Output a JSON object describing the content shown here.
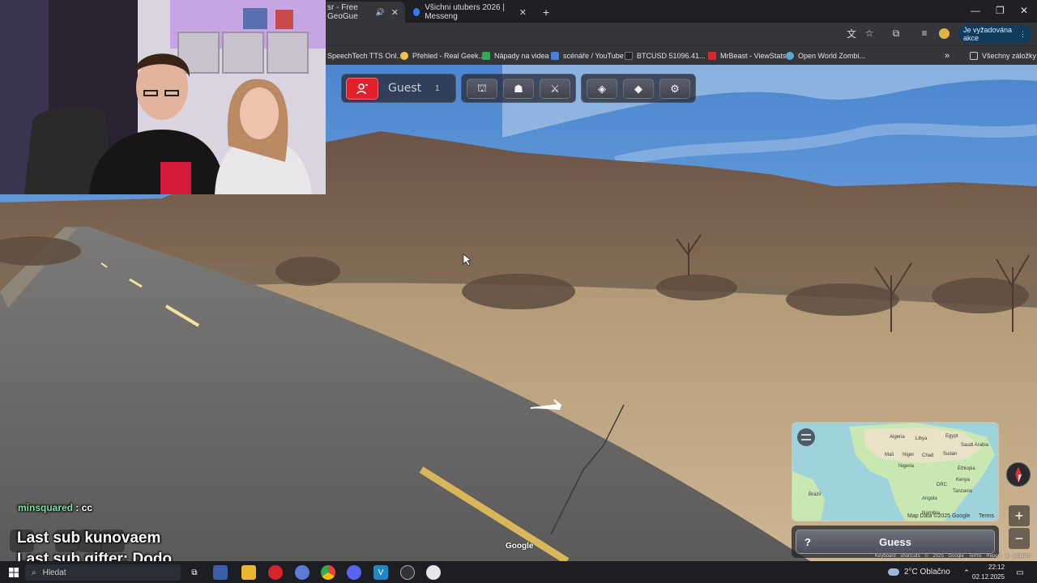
{
  "browser": {
    "tabs": [
      {
        "title": "sr - Free GeoGue",
        "active": true,
        "audio_icon": "speaker-icon"
      },
      {
        "title": "Všichni utubers 2026 | Messeng",
        "active": false,
        "icon": "messenger-icon"
      }
    ],
    "new_tab_label": "+",
    "action_pill": "Je vyžadována akce",
    "bookmarks": [
      {
        "label": "SpeechTech TTS Onl...",
        "color": "#6a6f7c"
      },
      {
        "label": "Přehled - Real Geek...",
        "color": "#f2c14e"
      },
      {
        "label": "Nápady na videa",
        "color": "#34a853"
      },
      {
        "label": "scénáře / YouTube",
        "color": "#4a7fe0"
      },
      {
        "label": "BTCUSD 51096.41...",
        "color": "#222222"
      },
      {
        "label": "MrBeast - ViewStats",
        "color": "#d62a2a"
      },
      {
        "label": "Open World Zombi...",
        "color": "#5aa7d6"
      }
    ],
    "bookmarks_overflow": "»",
    "all_bookmarks": "Všechny záložky"
  },
  "game": {
    "player": {
      "name": "Guest",
      "count": "1"
    },
    "toolbar_groups": [
      [
        "user-icon"
      ],
      [
        "podium-icon",
        "party-icon",
        "crossed-swords-icon"
      ],
      [
        "layers-icon",
        "graduation-cap-icon",
        "settings-gear-icon"
      ]
    ],
    "guess_label": "Guess",
    "help_label": "?",
    "zoom_in": "+",
    "zoom_out": "−",
    "google_watermark": "Google",
    "legal_links": [
      "Keyboard shortcuts",
      "© 2025 Google",
      "Terms",
      "Report a problem"
    ],
    "minimap": {
      "attribution": "Map Data ©2025 Google",
      "terms": "Terms",
      "labels": [
        "Algeria",
        "Libya",
        "Egypt",
        "Saudi Arabia",
        "Mali",
        "Niger",
        "Chad",
        "Sudan",
        "Nigeria",
        "Ethiopia",
        "DRC",
        "Kenya",
        "Tanzania",
        "Angola",
        "Namibia",
        "Brazil"
      ]
    }
  },
  "stream_overlay": {
    "chat_user": "minsquared",
    "chat_sep": " : ",
    "chat_message": "cc",
    "last_sub": "Last sub kunovaem",
    "last_gifter": "Last sub gifter: Dodo"
  },
  "taskbar": {
    "search_placeholder": "Hledat",
    "weather": "2°C  Oblačno",
    "time": "22:12",
    "date": "02.12.2025"
  }
}
